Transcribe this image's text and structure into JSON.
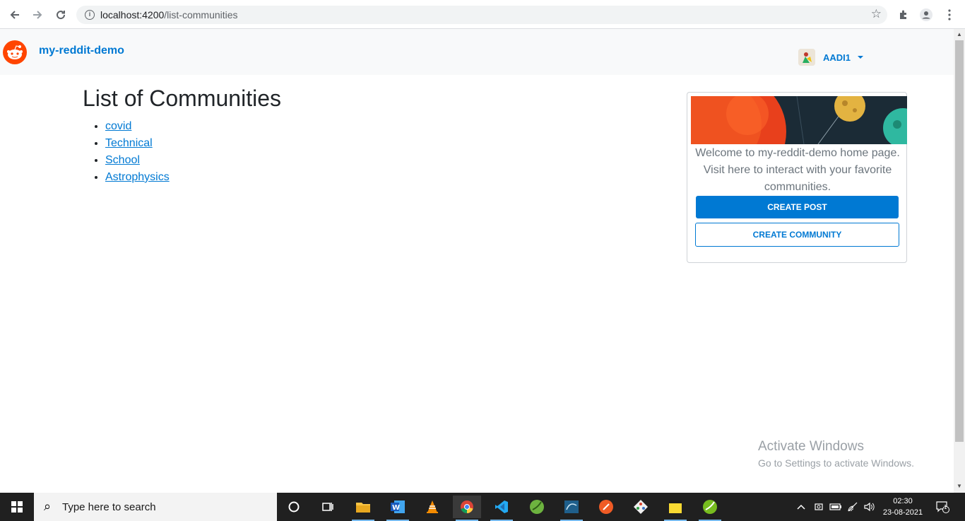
{
  "browser": {
    "url_host": "localhost:4200",
    "url_path": "/list-communities"
  },
  "header": {
    "brand": "my-reddit-demo",
    "username": "AADI1"
  },
  "main": {
    "title": "List of Communities",
    "communities": [
      "covid",
      "Technical",
      "School",
      "Astrophysics"
    ]
  },
  "sidebar": {
    "welcome_text": "Welcome to my-reddit-demo home page. Visit here to interact with your favorite communities.",
    "create_post_label": "CREATE POST",
    "create_community_label": "CREATE COMMUNITY"
  },
  "watermark": {
    "line1": "Activate Windows",
    "line2": "Go to Settings to activate Windows."
  },
  "taskbar": {
    "search_placeholder": "Type here to search",
    "time": "02:30",
    "date": "23-08-2021",
    "notification_count": "1"
  },
  "colors": {
    "brand_blue": "#0079d3",
    "reddit_orange": "#ff4500"
  }
}
